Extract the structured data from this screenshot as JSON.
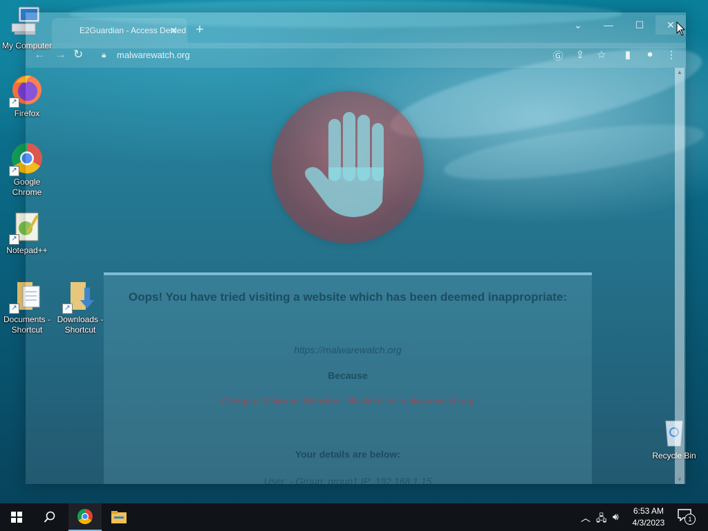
{
  "desktop": {
    "icons": [
      {
        "label": "My Computer"
      },
      {
        "label": "Firefox"
      },
      {
        "label": "Google Chrome"
      },
      {
        "label": "Notepad++"
      },
      {
        "label": "Documents - Shortcut"
      },
      {
        "label": "Downloads - Shortcut"
      },
      {
        "label": "Recycle Bin"
      }
    ]
  },
  "browser": {
    "tab_title": "E2Guardian - Access Denied",
    "url": "malwarewatch.org",
    "page": {
      "heading": "Oops! You have tried visiting a website which has been deemed inappropriate:",
      "blocked_url": "https://malwarewatch.org",
      "because_label": "Because",
      "category_line": "Category: Malicious Websites - Blocked site: malwarewatch.org",
      "details_label": "Your details are below:",
      "user_line": "User: -   Group: group1   IP: 192.168.1.15"
    }
  },
  "taskbar": {
    "time": "6:53 AM",
    "date": "4/3/2023",
    "notification_count": "1"
  },
  "colors": {
    "accent_red": "#d93a3a",
    "taskbar_bg": "#101418",
    "wallpaper": "#0b6f8c"
  }
}
